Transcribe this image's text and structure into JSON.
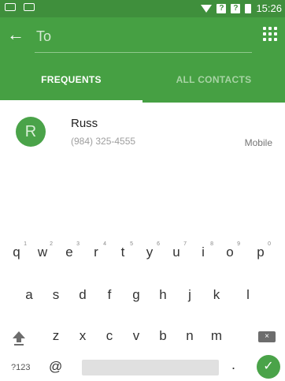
{
  "status_bar": {
    "time": "15:26",
    "icons": [
      "voicemail-icon",
      "image-icon",
      "wifi-icon",
      "no-sim-icon",
      "no-sim-icon",
      "battery-icon"
    ]
  },
  "toolbar": {
    "back_icon": "arrow-back-icon",
    "to_placeholder": "To",
    "dialpad_icon": "dialpad-icon"
  },
  "tabs": [
    {
      "label": "FREQUENTS",
      "selected": true
    },
    {
      "label": "ALL CONTACTS",
      "selected": false
    }
  ],
  "contacts": [
    {
      "initial": "R",
      "name": "Russ",
      "phone": "(984) 325-4555",
      "type": "Mobile"
    }
  ],
  "keyboard": {
    "row1": [
      {
        "k": "q",
        "h": "1"
      },
      {
        "k": "w",
        "h": "2"
      },
      {
        "k": "e",
        "h": "3"
      },
      {
        "k": "r",
        "h": "4"
      },
      {
        "k": "t",
        "h": "5"
      },
      {
        "k": "y",
        "h": "6"
      },
      {
        "k": "u",
        "h": "7"
      },
      {
        "k": "i",
        "h": "8"
      },
      {
        "k": "o",
        "h": "9"
      },
      {
        "k": "p",
        "h": "0"
      }
    ],
    "row2": [
      "a",
      "s",
      "d",
      "f",
      "g",
      "h",
      "j",
      "k",
      "l"
    ],
    "row3": [
      "z",
      "x",
      "c",
      "v",
      "b",
      "n",
      "m"
    ],
    "symbols_label": "?123",
    "at_label": "@",
    "period_label": "."
  },
  "colors": {
    "accent": "#46a043",
    "status_bar": "#3f8f3c"
  }
}
